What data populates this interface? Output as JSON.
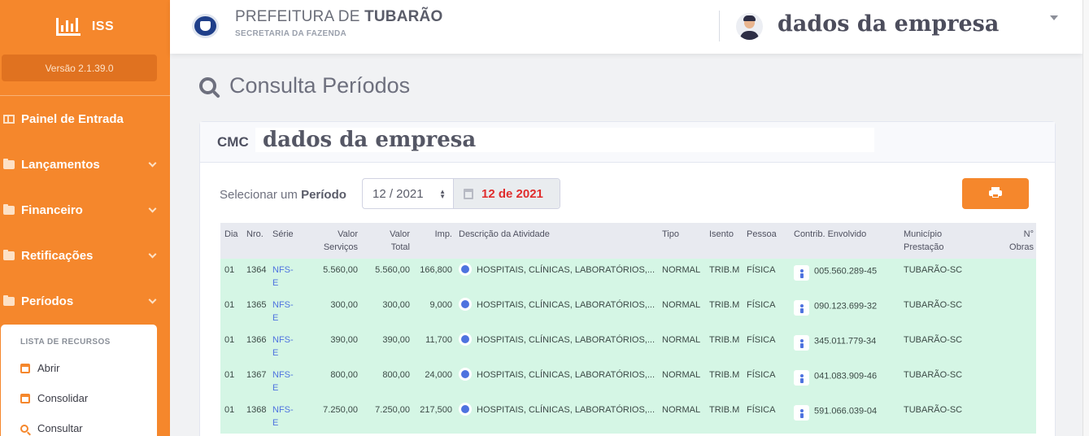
{
  "sidebar": {
    "brand": "ISS",
    "version": "Versão 2.1.39.0",
    "items": [
      {
        "label": "Painel de Entrada"
      },
      {
        "label": "Lançamentos"
      },
      {
        "label": "Financeiro"
      },
      {
        "label": "Retificações"
      },
      {
        "label": "Períodos"
      }
    ],
    "submenu": {
      "heading": "LISTA DE RECURSOS",
      "items": [
        {
          "label": "Abrir"
        },
        {
          "label": "Consolidar"
        },
        {
          "label": "Consultar"
        }
      ]
    }
  },
  "header": {
    "title_prefix": "PREFEITURA DE",
    "title_city": "TUBARÃO",
    "subtitle": "SECRETARIA DA FAZENDA",
    "company": "dados da empresa"
  },
  "page": {
    "title": "Consulta Períodos"
  },
  "card": {
    "cmc_label": "CMC",
    "cmc_value": "dados da empresa",
    "select_label_prefix": "Selecionar um",
    "select_label_bold": "Período",
    "period_value": "12 / 2021",
    "period_display": "12 de 2021"
  },
  "colors": {
    "accent": "#f5872c",
    "row_bg": "#d5f6e5",
    "date_red": "#e02d2d",
    "link_blue": "#4e73df"
  },
  "table": {
    "headers": {
      "dia": "Dia",
      "nro": "Nro.",
      "serie": "Série",
      "valor_servicos_1": "Valor",
      "valor_servicos_2": "Serviços",
      "valor_total_1": "Valor",
      "valor_total_2": "Total",
      "imp": "Imp.",
      "descricao": "Descrição da Atividade",
      "tipo": "Tipo",
      "isento": "Isento",
      "pessoa": "Pessoa",
      "contrib": "Contrib. Envolvido",
      "municipio_1": "Município",
      "municipio_2": "Prestação",
      "obras_1": "N°",
      "obras_2": "Obras"
    },
    "rows": [
      {
        "dia": "01",
        "nro": "1364",
        "serie_1": "NFS-",
        "serie_2": "E",
        "valor_servicos": "5.560,00",
        "valor_total": "5.560,00",
        "imp": "166,800",
        "descricao": "HOSPITAIS, CLÍNICAS, LABORATÓRIOS,...",
        "tipo": "NORMAL",
        "isento": "TRIB.M",
        "pessoa": "FÍSICA",
        "contrib": "005.560.289-45",
        "municipio": "TUBARÃO-SC",
        "obras": ""
      },
      {
        "dia": "01",
        "nro": "1365",
        "serie_1": "NFS-",
        "serie_2": "E",
        "valor_servicos": "300,00",
        "valor_total": "300,00",
        "imp": "9,000",
        "descricao": "HOSPITAIS, CLÍNICAS, LABORATÓRIOS,...",
        "tipo": "NORMAL",
        "isento": "TRIB.M",
        "pessoa": "FÍSICA",
        "contrib": "090.123.699-32",
        "municipio": "TUBARÃO-SC",
        "obras": ""
      },
      {
        "dia": "01",
        "nro": "1366",
        "serie_1": "NFS-",
        "serie_2": "E",
        "valor_servicos": "390,00",
        "valor_total": "390,00",
        "imp": "11,700",
        "descricao": "HOSPITAIS, CLÍNICAS, LABORATÓRIOS,...",
        "tipo": "NORMAL",
        "isento": "TRIB.M",
        "pessoa": "FÍSICA",
        "contrib": "345.011.779-34",
        "municipio": "TUBARÃO-SC",
        "obras": ""
      },
      {
        "dia": "01",
        "nro": "1367",
        "serie_1": "NFS-",
        "serie_2": "E",
        "valor_servicos": "800,00",
        "valor_total": "800,00",
        "imp": "24,000",
        "descricao": "HOSPITAIS, CLÍNICAS, LABORATÓRIOS,...",
        "tipo": "NORMAL",
        "isento": "TRIB.M",
        "pessoa": "FÍSICA",
        "contrib": "041.083.909-46",
        "municipio": "TUBARÃO-SC",
        "obras": ""
      },
      {
        "dia": "01",
        "nro": "1368",
        "serie_1": "NFS-",
        "serie_2": "E",
        "valor_servicos": "7.250,00",
        "valor_total": "7.250,00",
        "imp": "217,500",
        "descricao": "HOSPITAIS, CLÍNICAS, LABORATÓRIOS,...",
        "tipo": "NORMAL",
        "isento": "TRIB.M",
        "pessoa": "FÍSICA",
        "contrib": "591.066.039-04",
        "municipio": "TUBARÃO-SC",
        "obras": ""
      }
    ]
  }
}
